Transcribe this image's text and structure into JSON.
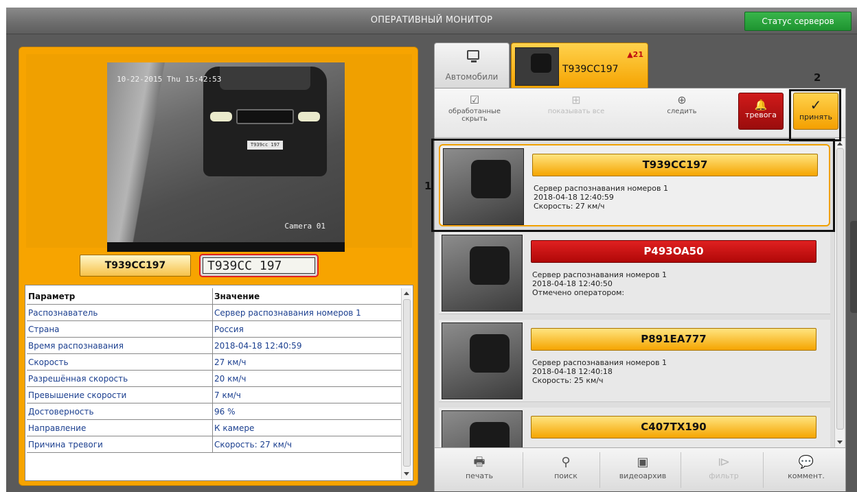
{
  "header": {
    "title": "ОПЕРАТИВНЫЙ МОНИТОР",
    "status_button": "Статус серверов"
  },
  "camera_view": {
    "timestamp": "10-22-2015 Thu 15:42:53",
    "camera_name": "Camera 01",
    "car_plate_text": "T939cc 197"
  },
  "recognized_plate": {
    "number": "T939CC197",
    "plate_image_text": "T939CC 197"
  },
  "params_table": {
    "headers": [
      "Параметр",
      "Значение"
    ],
    "rows": [
      [
        "Распознаватель",
        "Сервер распознавания номеров 1"
      ],
      [
        "Страна",
        "Россия"
      ],
      [
        "Время распознавания",
        "2018-04-18 12:40:59"
      ],
      [
        "Скорость",
        "27 км/ч"
      ],
      [
        "Разрешённая скорость",
        "20 км/ч"
      ],
      [
        "Превышение скорости",
        "7 км/ч"
      ],
      [
        "Достоверность",
        "96 %"
      ],
      [
        "Направление",
        "К камере"
      ],
      [
        "Причина тревоги",
        "Скорость: 27 км/ч"
      ]
    ]
  },
  "tabs": {
    "cars_label": "Автомобили",
    "camera_tab_plate": "T939CC197",
    "camera_tab_alarms": "▲21"
  },
  "toolbar": {
    "hide_processed": "обработанные скрыть",
    "show_all": "показывать все",
    "follow": "следить",
    "alarm": "тревога",
    "accept": "принять"
  },
  "annotations": {
    "label_1": "1",
    "label_2": "2"
  },
  "events": [
    {
      "plate": "T939CC197",
      "line1": "Сервер распознавания номеров 1",
      "line2": "2018-04-18 12:40:59",
      "line3": "Скорость: 27 км/ч",
      "status": "normal"
    },
    {
      "plate": "P493OA50",
      "line1": "Сервер распознавания номеров 1",
      "line2": "2018-04-18 12:40:50",
      "line3": "Отмечено оператором:",
      "status": "alarm"
    },
    {
      "plate": "P891EA777",
      "line1": "Сервер распознавания номеров 1",
      "line2": "2018-04-18 12:40:18",
      "line3": "Скорость: 25 км/ч",
      "status": "normal"
    },
    {
      "plate": "C407TX190",
      "line1": "",
      "line2": "",
      "line3": "",
      "status": "normal"
    }
  ],
  "bottombar": {
    "print": "печать",
    "search": "поиск",
    "archive": "видеоархив",
    "filter": "фильтр",
    "comment": "коммент."
  },
  "colors": {
    "accent_orange": "#f7a400",
    "alarm_red": "#c01010",
    "status_green": "#1f9431"
  }
}
